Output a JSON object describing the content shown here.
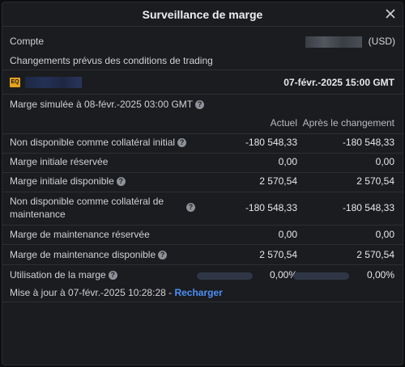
{
  "modal": {
    "title": "Surveillance de marge"
  },
  "account": {
    "label": "Compte",
    "currency": "(USD)"
  },
  "trading_changes": {
    "heading": "Changements prévus des conditions de trading",
    "badge": "EQ",
    "change_datetime": "07-févr.-2025 15:00 GMT"
  },
  "simulated": {
    "label": "Marge simulée à 08-févr.-2025 03:00 GMT"
  },
  "table": {
    "columns": {
      "current": "Actuel",
      "after": "Après le changement"
    },
    "rows": [
      {
        "label": "Non disponible comme collatéral initial",
        "has_help": true,
        "current": "-180 548,33",
        "after": "-180 548,33"
      },
      {
        "label": "Marge initiale réservée",
        "has_help": false,
        "current": "0,00",
        "after": "0,00"
      },
      {
        "label": "Marge initiale disponible",
        "has_help": true,
        "current": "2 570,54",
        "after": "2 570,54"
      },
      {
        "label_line1": "Non disponible comme collatéral de",
        "label_line2": "maintenance",
        "has_help": true,
        "current": "-180 548,33",
        "after": "-180 548,33"
      },
      {
        "label": "Marge de maintenance réservée",
        "has_help": false,
        "current": "0,00",
        "after": "0,00"
      },
      {
        "label": "Marge de maintenance disponible",
        "has_help": true,
        "current": "2 570,54",
        "after": "2 570,54"
      }
    ],
    "utilization": {
      "label": "Utilisation de la marge",
      "current": "0,00%",
      "after": "0,00%",
      "current_fraction": 0,
      "after_fraction": 0
    }
  },
  "footer": {
    "updated": "Mise à jour à 07-févr.-2025 10:28:28 - ",
    "reload": "Recharger"
  },
  "icons": {
    "close": "close-icon",
    "help": "help-icon"
  },
  "colors": {
    "accent": "#4c8ff5",
    "badge": "#e5a21a",
    "background": "#1b1c1f"
  }
}
